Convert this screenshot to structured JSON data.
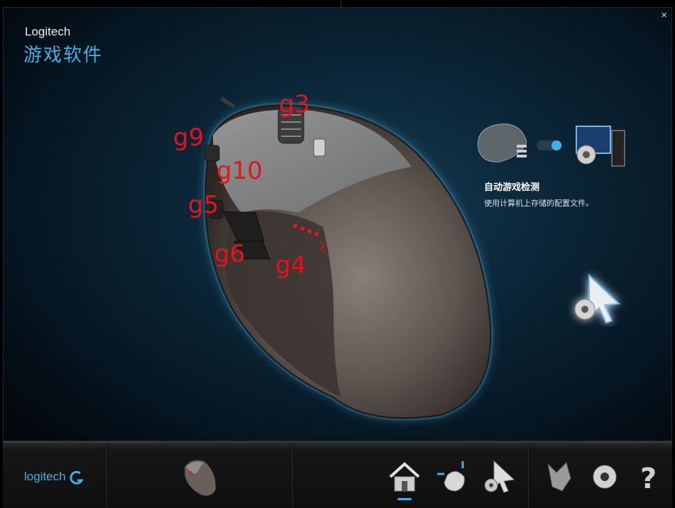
{
  "window": {
    "brand": "Logitech",
    "title": "游戏软件",
    "close_label": "×"
  },
  "device_labels": [
    {
      "id": "g3",
      "text": "g3"
    },
    {
      "id": "g9",
      "text": "g9"
    },
    {
      "id": "g10",
      "text": "g10"
    },
    {
      "id": "g5",
      "text": "g5"
    },
    {
      "id": "g6",
      "text": "g6"
    },
    {
      "id": "g4",
      "text": "g4"
    }
  ],
  "auto_detect": {
    "title": "自动游戏检测",
    "description": "使用计算机上存储的配置文件。",
    "toggle_on": true
  },
  "bottombar": {
    "logo_text": "logitech",
    "nav_items": [
      "home-icon",
      "mouse-customize-icon",
      "pointer-settings-icon",
      "game-profile-icon",
      "settings-icon",
      "help-icon"
    ],
    "active_item": "home-icon"
  },
  "colors": {
    "accent": "#3fb0e8",
    "label_red": "#e8121b"
  }
}
